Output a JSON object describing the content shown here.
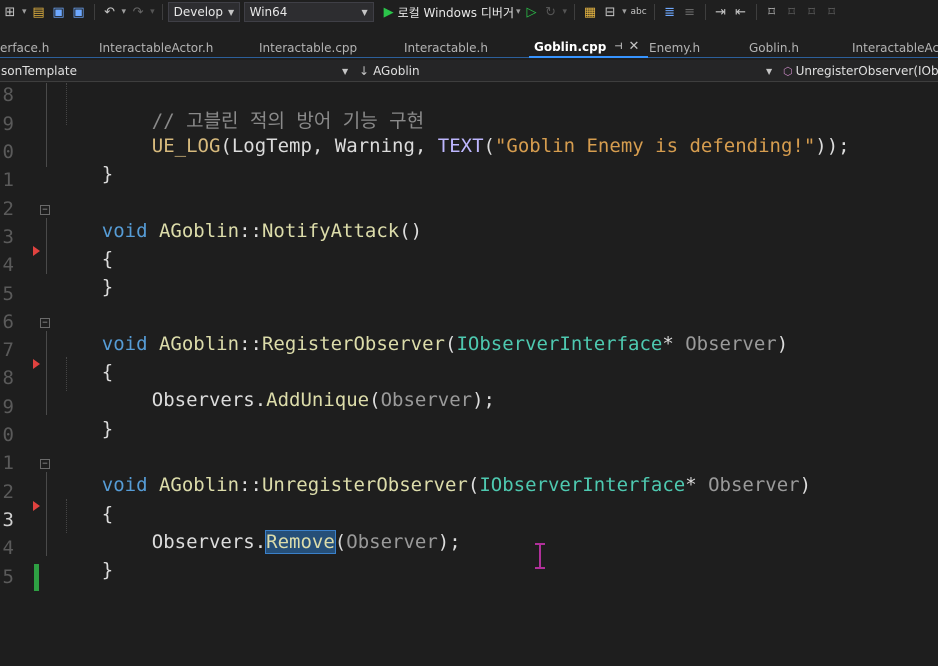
{
  "toolbar": {
    "config_selected": "Develop",
    "platform_selected": "Win64",
    "debugger_label": "로컬 Windows 디버거"
  },
  "tabs": [
    {
      "label": "erface.h"
    },
    {
      "label": "InteractableActor.h"
    },
    {
      "label": "Interactable.cpp"
    },
    {
      "label": "Interactable.h"
    },
    {
      "label": "Goblin.cpp"
    },
    {
      "label": "Enemy.h"
    },
    {
      "label": "Goblin.h"
    },
    {
      "label": "InteractableAct"
    }
  ],
  "navbar": {
    "project": "sonTemplate",
    "scope": "AGoblin",
    "member": "UnregisterObserver(IObs"
  },
  "editor": {
    "line_numbers": [
      "8",
      "9",
      "0",
      "1",
      "2",
      "3",
      "4",
      "5",
      "6",
      "7",
      "8",
      "9",
      "0",
      "1",
      "2",
      "3",
      "4",
      "5"
    ],
    "current_line": "3",
    "lines": {
      "l0_comment": "// 고블린 적의 방어 기능 구현",
      "l1_macro": "UE_LOG",
      "l1_p1": "(",
      "l1_arg1": "LogTemp, Warning, ",
      "l1_text": "TEXT",
      "l1_p2": "(",
      "l1_str": "\"Goblin Enemy is defending!\"",
      "l1_end": "));",
      "l2": "}",
      "l4_void": "void",
      "l4_cls": "AGoblin",
      "l4_sep": "::",
      "l4_fn": "NotifyAttack",
      "l4_par": "()",
      "l5": "{",
      "l6": "}",
      "l8_void": "void",
      "l8_cls": "AGoblin",
      "l8_sep": "::",
      "l8_fn": "RegisterObserver",
      "l8_p1": "(",
      "l8_type": "IObserverInterface",
      "l8_star": "* ",
      "l8_param": "Observer",
      "l8_p2": ")",
      "l9": "{",
      "l10_obj": "Observers.",
      "l10_fn": "AddUnique",
      "l10_p1": "(",
      "l10_arg": "Observer",
      "l10_end": ");",
      "l11": "}",
      "l13_void": "void",
      "l13_cls": "AGoblin",
      "l13_sep": "::",
      "l13_fn": "UnregisterObserver",
      "l13_p1": "(",
      "l13_type": "IObserverInterface",
      "l13_star": "* ",
      "l13_param": "Observer",
      "l13_p2": ")",
      "l14": "{",
      "l15_obj": "Observers.",
      "l15_fn": "Remove",
      "l15_p1": "(",
      "l15_arg": "Observer",
      "l15_end": ");",
      "l16": "}"
    }
  },
  "colors": {
    "keyword": "#569cd6",
    "function": "#dcdcaa",
    "type": "#4ec9b0",
    "string": "#d69d4f",
    "comment": "#57a64a",
    "macro": "#beb7ff",
    "selection": "#264f78",
    "change_bar": "#2ea043",
    "breakpoint_marker": "#e0423f",
    "accent": "#3794ff"
  }
}
